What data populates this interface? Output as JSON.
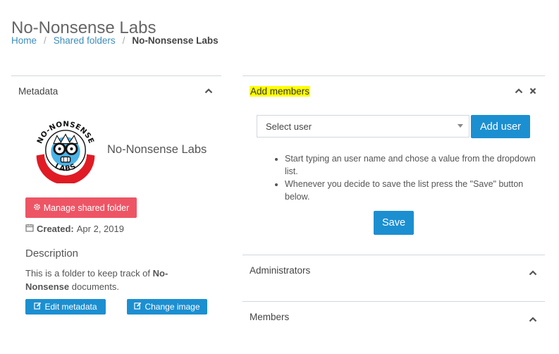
{
  "page": {
    "title": "No-Nonsense Labs"
  },
  "breadcrumb": {
    "home": "Home",
    "sep": "/",
    "shared": "Shared folders",
    "current": "No-Nonsense Labs"
  },
  "metadata": {
    "title": "Metadata",
    "logo_text_top": "NO-NONSENSE",
    "logo_text_bottom": "LABS",
    "folder_name": "No-Nonsense Labs",
    "manage_label": "Manage shared folder",
    "created_label": "Created:",
    "created_value": "Apr 2, 2019",
    "description_heading": "Description",
    "description_pre": "This is a folder to keep track of ",
    "description_bold": "No-Nonsense",
    "description_post": " documents.",
    "edit_label": "Edit metadata",
    "change_label": "Change image"
  },
  "add_members": {
    "title": "Add members",
    "select_placeholder": "Select user",
    "add_button": "Add user",
    "hints": [
      "Start typing an user name and chose a value from the dropdown list.",
      "Whenever you decide to save the list press the \"Save\" button below."
    ],
    "save_button": "Save"
  },
  "administrators": {
    "title": "Administrators"
  },
  "members": {
    "title": "Members"
  },
  "colors": {
    "primary": "#1c8fd1",
    "danger": "#ed5565",
    "link": "#3c8dbc",
    "highlight": "#ffff00"
  },
  "icons": [
    "chevron-up-icon",
    "close-icon",
    "gear-icon",
    "calendar-icon",
    "edit-icon",
    "caret-down-icon"
  ]
}
